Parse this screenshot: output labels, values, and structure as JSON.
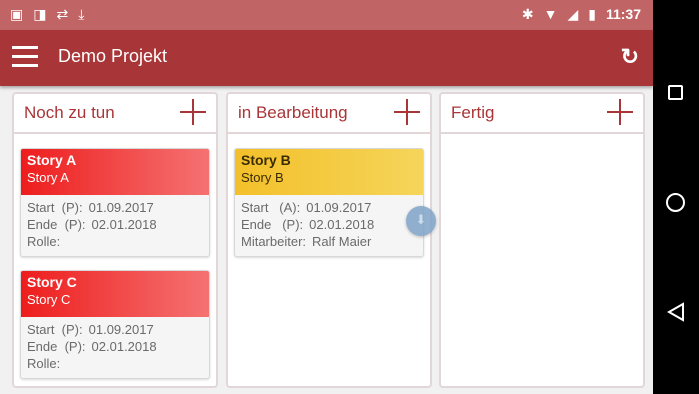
{
  "status_bar": {
    "left_icons": [
      "image-icon",
      "chat-icon",
      "sync-icon",
      "download-icon"
    ],
    "right_icons": [
      "bluetooth-icon",
      "wifi-icon",
      "signal-icon",
      "battery-icon"
    ],
    "time": "11:37"
  },
  "app_bar": {
    "title": "Demo Projekt",
    "menu_icon": "menu-icon",
    "refresh_icon": "refresh-icon"
  },
  "columns": [
    {
      "title": "Noch zu tun",
      "cards": [
        {
          "name": "Story A",
          "subtitle": "Story A",
          "color": "#ee1d1d",
          "rows": [
            {
              "label": "Start  (P):",
              "value": "01.09.2017"
            },
            {
              "label": "Ende  (P):",
              "value": "02.01.2018"
            },
            {
              "label": "Rolle:",
              "value": ""
            }
          ]
        },
        {
          "name": "Story C",
          "subtitle": "Story C",
          "color": "#ee1d1d",
          "rows": [
            {
              "label": "Start  (P):",
              "value": "01.09.2017"
            },
            {
              "label": "Ende  (P):",
              "value": "02.01.2018"
            },
            {
              "label": "Rolle:",
              "value": ""
            }
          ]
        }
      ]
    },
    {
      "title": "in Bearbeitung",
      "cards": [
        {
          "name": "Story B",
          "subtitle": "Story B",
          "color": "#f3c02a",
          "rows": [
            {
              "label": "Start   (A):",
              "value": "01.09.2017"
            },
            {
              "label": "Ende   (P):",
              "value": "02.01.2018"
            },
            {
              "label": "Mitarbeiter:",
              "value": "Ralf Maier"
            }
          ]
        }
      ]
    },
    {
      "title": "Fertig",
      "cards": []
    }
  ],
  "colors": {
    "status_bar": "#c16466",
    "app_bar": "#a83537",
    "accent": "#a83537"
  }
}
